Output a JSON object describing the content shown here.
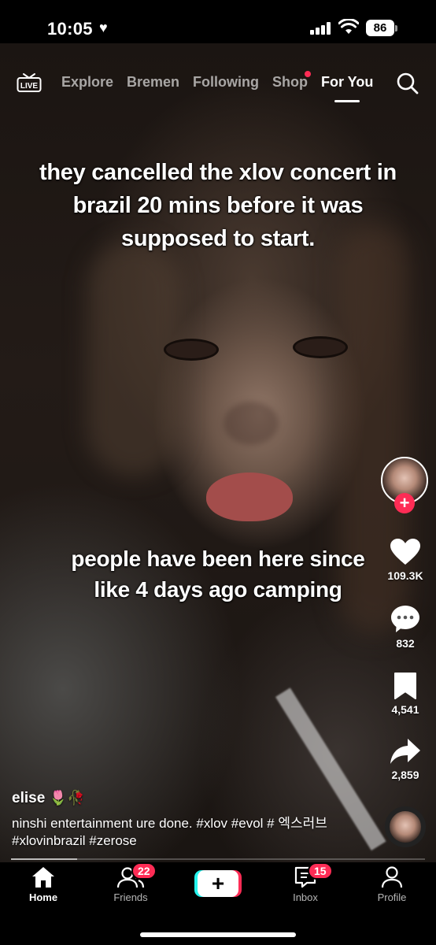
{
  "status_bar": {
    "time": "10:05",
    "battery": "86"
  },
  "top_nav": {
    "tabs": [
      {
        "label": "Explore",
        "active": false
      },
      {
        "label": "Bremen",
        "active": false
      },
      {
        "label": "Following",
        "active": false
      },
      {
        "label": "Shop",
        "active": false,
        "dot": true
      },
      {
        "label": "For You",
        "active": true
      }
    ],
    "live_label": "LIVE"
  },
  "video": {
    "caption_top": "they cancelled the xlov concert in brazil 20 mins before it was supposed to start.",
    "caption_middle": "people have been here since like 4 days ago camping",
    "progress": 0.16
  },
  "actions": {
    "likes": "109.3K",
    "comments": "832",
    "saves": "4,541",
    "shares": "2,859"
  },
  "post": {
    "username": "elise",
    "username_emoji": "🌷🥀",
    "description": "ninshi entertainment ure done. #xlov #evol # 엑스러브 #xlovinbrazil #zerose"
  },
  "bottom_nav": {
    "home": "Home",
    "friends": "Friends",
    "friends_badge": "22",
    "create": "+",
    "inbox": "Inbox",
    "inbox_badge": "15",
    "profile": "Profile"
  },
  "colors": {
    "accent": "#fe2c55",
    "cyan": "#25f4ee"
  }
}
